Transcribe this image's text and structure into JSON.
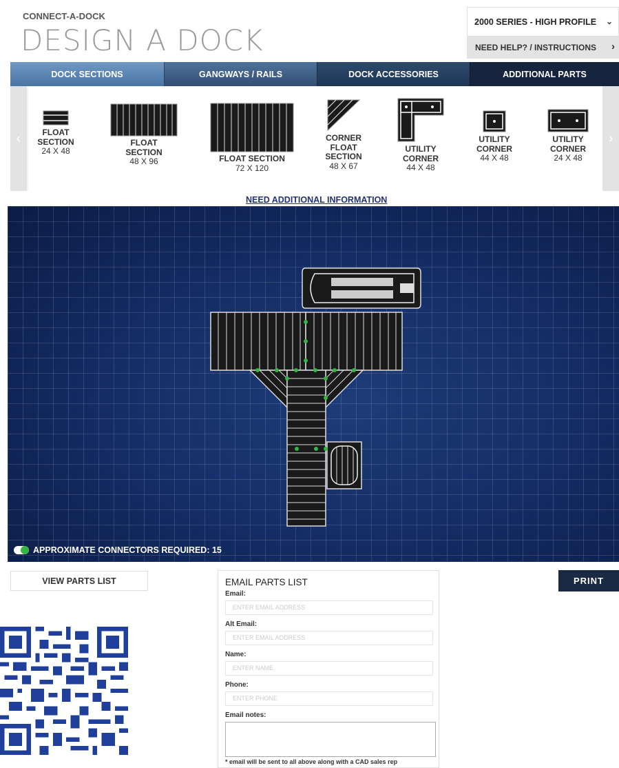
{
  "header": {
    "brand": "CONNECT-A-DOCK",
    "title": "DESIGN A DOCK",
    "series_select": "2000 SERIES - HIGH PROFILE",
    "help_link": "NEED HELP? / INSTRUCTIONS"
  },
  "tabs": [
    {
      "label": "DOCK SECTIONS"
    },
    {
      "label": "GANGWAYS / RAILS"
    },
    {
      "label": "DOCK ACCESSORIES"
    },
    {
      "label": "ADDITIONAL PARTS"
    }
  ],
  "products": [
    {
      "line1": "FLOAT",
      "line2": "SECTION",
      "size": "24 X 48"
    },
    {
      "line1": "FLOAT",
      "line2": "SECTION",
      "size": "48 X 96"
    },
    {
      "line1": "FLOAT SECTION",
      "line2": "",
      "size": "72 X 120"
    },
    {
      "line1": "CORNER",
      "line2": "FLOAT",
      "line3": "SECTION",
      "size": "48 X 67"
    },
    {
      "line1": "UTILITY",
      "line2": "CORNER",
      "size": "44 X 48"
    },
    {
      "line1": "UTILITY",
      "line2": "CORNER",
      "size": "44 X 48"
    },
    {
      "line1": "UTILITY",
      "line2": "CORNER",
      "size": "24 X 48"
    }
  ],
  "need_info_link": "NEED ADDITIONAL INFORMATION",
  "canvas": {
    "connectors_label": "APPROXIMATE CONNECTORS REQUIRED: 15"
  },
  "actions": {
    "view_parts": "VIEW PARTS LIST",
    "print": "PRINT"
  },
  "email_form": {
    "title": "EMAIL PARTS LIST",
    "email_label": "Email:",
    "email_placeholder": "ENTER EMAIL ADDRESS",
    "alt_email_label": "Alt Email:",
    "alt_email_placeholder": "ENTER EMAIL ADDRESS",
    "name_label": "Name:",
    "name_placeholder": "ENTER NAME",
    "phone_label": "Phone:",
    "phone_placeholder": "ENTER PHONE",
    "notes_label": "Email notes:",
    "footnote": "* email will be sent to all above along with a CAD sales rep"
  },
  "colors": {
    "tab_active": "#5b86b5",
    "tab_dark": "#16253d",
    "canvas_bg": "#14306a",
    "connector_green": "#35b542",
    "print_bg": "#1b2a44"
  }
}
